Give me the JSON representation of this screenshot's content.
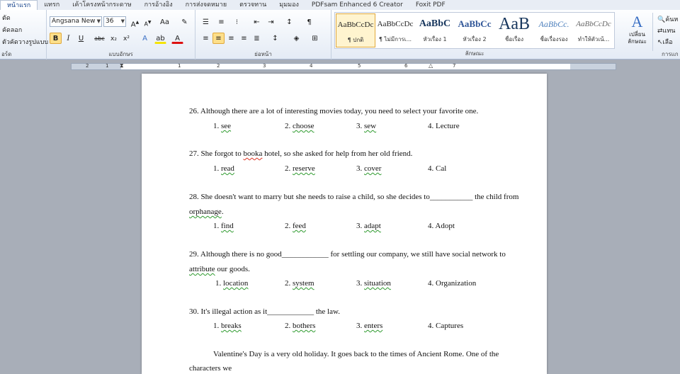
{
  "ribbon_tabs": [
    "หน้าแรก",
    "แทรก",
    "เค้าโครงหน้ากระดาษ",
    "การอ้างอิง",
    "การส่งจดหมาย",
    "ตรวจทาน",
    "มุมมอง",
    "PDFsam Enhanced 6 Creator",
    "Foxit PDF"
  ],
  "clipboard": {
    "cut": "ตัด",
    "copy": "คัดลอก",
    "format_painter": "ตัวคัดวางรูปแบบ",
    "group": "อร์ด"
  },
  "font": {
    "name": "Angsana New",
    "size": "36",
    "group": "แบบอักษร"
  },
  "paragraph": {
    "group": "ย่อหน้า"
  },
  "styles": {
    "group": "ลักษณะ",
    "items": [
      {
        "preview": "AaBbCcDc",
        "name": "¶ ปกติ"
      },
      {
        "preview": "AaBbCcDc",
        "name": "¶ ไม่มีการเ..."
      },
      {
        "preview": "AaBbC",
        "name": "หัวเรื่อง 1"
      },
      {
        "preview": "AaBbCc",
        "name": "หัวเรื่อง 2"
      },
      {
        "preview": "AaB",
        "name": "ชื่อเรื่อง"
      },
      {
        "preview": "AaBbCc.",
        "name": "ชื่อเรื่องรอง"
      },
      {
        "preview": "AaBbCcDc",
        "name": "ทำให้ตัวเน้..."
      }
    ],
    "change_styles": "เปลี่ยน ลักษณะ"
  },
  "editing": {
    "find": "ค้นห",
    "replace": "แทน",
    "select": "เลือ",
    "group": "การแก"
  },
  "ruler_numbers": [
    "1",
    "2",
    "1",
    "2",
    "3",
    "4",
    "5",
    "6",
    "7"
  ],
  "document": {
    "q26": {
      "text": "26. Although there are a lot of interesting movies today, you need to select your favorite one.",
      "options": [
        "1. see",
        "2. choose",
        "3. sew",
        "4. Lecture"
      ]
    },
    "q27": {
      "text_a": "27. She forgot to ",
      "text_b": "booka",
      "text_c": " hotel, so she asked for help from her old friend.",
      "options": [
        "1. read",
        "2. reserve",
        "3. cover",
        "4. Cal"
      ]
    },
    "q28": {
      "text": "28. She doesn't want to marry but she needs to raise a child, so she decides to___________  the child from",
      "text2": "orphanage",
      "text2_end": ".",
      "options": [
        "1. find",
        "2. feed",
        "3. adapt",
        "4. Adopt"
      ]
    },
    "q29": {
      "text": "29. Although there is no good____________  for settling our company, we still have social network to",
      "text2": "attribute",
      "text2_end": " our goods.",
      "options": [
        "1. location",
        "2. system",
        "3. situation",
        "4. Organization"
      ]
    },
    "q30": {
      "text": "30. It's illegal action as it____________  the law.",
      "options": [
        "1. breaks",
        "2. bothers",
        "3. enters",
        "4. Captures"
      ]
    },
    "passage_line1": "Valentine's Day is a very old holiday. It goes back to the times of Ancient Rome. One of the",
    "passage_line2": "characters we"
  }
}
